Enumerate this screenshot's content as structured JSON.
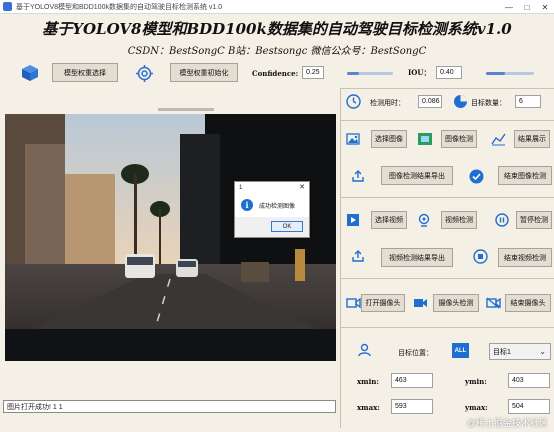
{
  "window": {
    "title": "基于YOLOV8模型和BDD100k数据集的自动驾驶目标检测系统 v1.0",
    "controls": [
      "—",
      "□",
      "✕"
    ]
  },
  "header": {
    "title": "基于YOLOV8模型和BDD100k数据集的自动驾驶目标检测系统v1.0",
    "subtitle": "CSDN：BestSongC   B站：Bestsongc   微信公众号：BestSongC"
  },
  "toolbar": {
    "model_select_label": "模型权重选择",
    "model_init_label": "模型权重初始化",
    "confidence_label": "Confidence:",
    "confidence_value": "0.25",
    "confidence_level": 0.25,
    "iou_label": "IOU：",
    "iou_value": "0.40",
    "iou_level": 0.4
  },
  "stats": {
    "time_label": "检测用时：",
    "time_value": "0.086",
    "count_label": "目标数量：",
    "count_value": "6"
  },
  "image_section": {
    "select_image": "选择图像",
    "detect_image": "图像检测",
    "show_results": "结果展示",
    "export_image": "图像检测结果导出",
    "stop_image": "结束图像检测"
  },
  "video_section": {
    "select_video": "选择视频",
    "detect_video": "视频检测",
    "pause_detect": "暂停检测",
    "export_video": "视频检测结果导出",
    "stop_video": "结束视频检测"
  },
  "camera_section": {
    "open_camera": "打开摄像头",
    "detect_camera": "摄像头检测",
    "close_camera": "结束摄像头"
  },
  "target": {
    "position_label": "目标位置：",
    "all_badge": "ALL",
    "selected": "目标1",
    "xmin_label": "xmin:",
    "xmin_value": "463",
    "ymin_label": "ymin:",
    "ymin_value": "403",
    "xmax_label": "xmax:",
    "xmax_value": "593",
    "ymax_label": "ymax:",
    "ymax_value": "504"
  },
  "dialog": {
    "title": "1",
    "close": "✕",
    "message": "成功检测图像",
    "ok_label": "OK"
  },
  "status": {
    "text": "图片打开成功! 1 1"
  },
  "watermark": "@稀土掘金技术社区",
  "colors": {
    "background": "#f5f0e6",
    "button": "#e3ddd2",
    "accent": "#1f6fd1"
  }
}
